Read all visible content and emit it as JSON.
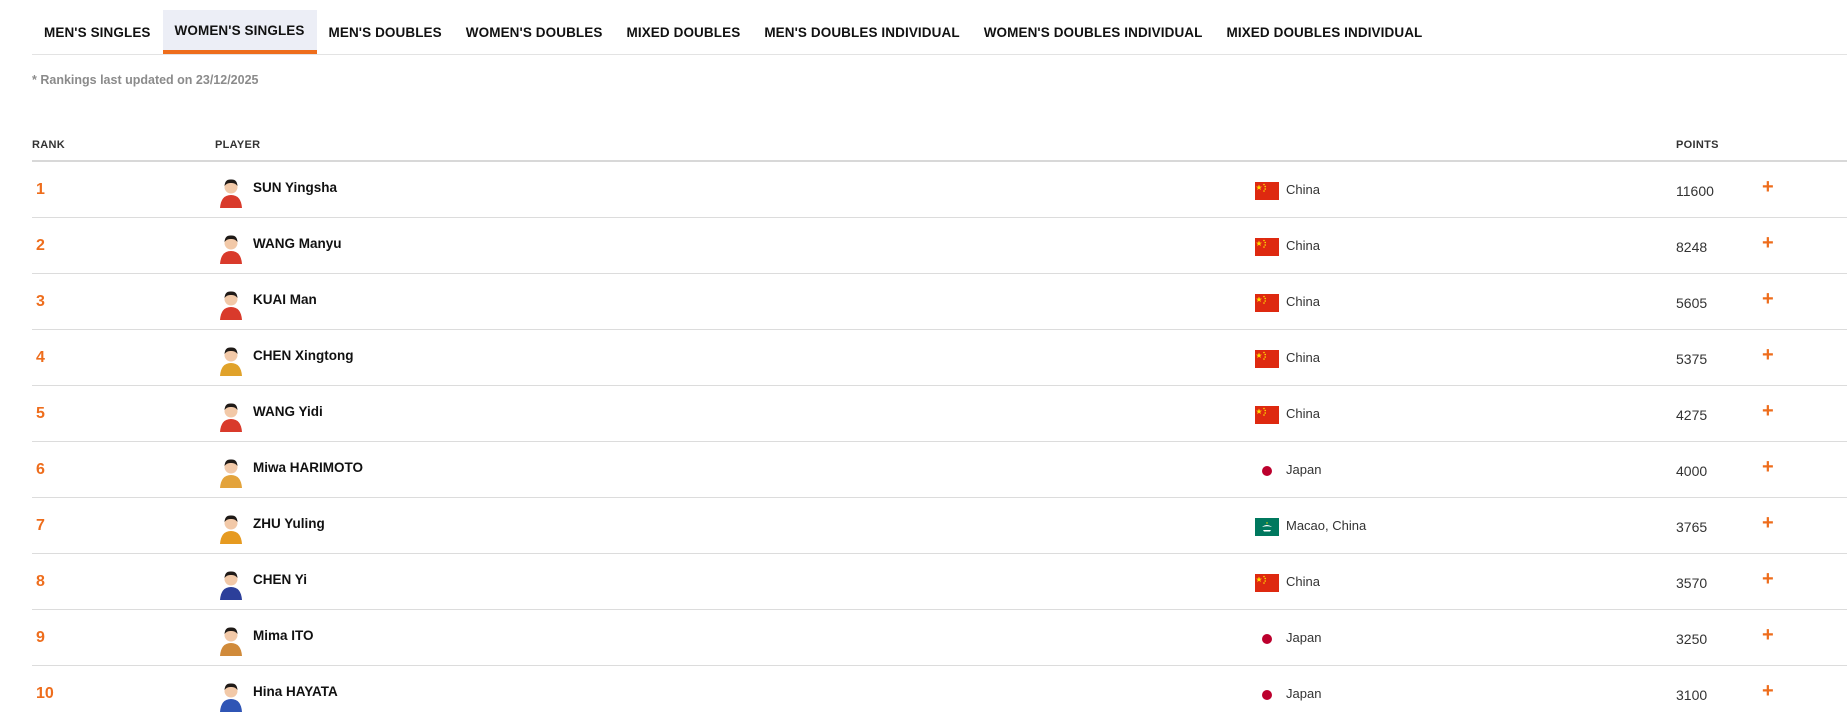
{
  "tabs": [
    {
      "label": "MEN'S SINGLES",
      "active": false
    },
    {
      "label": "WOMEN'S SINGLES",
      "active": true
    },
    {
      "label": "MEN'S DOUBLES",
      "active": false
    },
    {
      "label": "WOMEN'S DOUBLES",
      "active": false
    },
    {
      "label": "MIXED DOUBLES",
      "active": false
    },
    {
      "label": "MEN'S DOUBLES INDIVIDUAL",
      "active": false
    },
    {
      "label": "WOMEN'S DOUBLES INDIVIDUAL",
      "active": false
    },
    {
      "label": "MIXED DOUBLES INDIVIDUAL",
      "active": false
    }
  ],
  "note": "* Rankings last updated on 23/12/2025",
  "table": {
    "headers": {
      "rank": "RANK",
      "player": "PLAYER",
      "points": "POINTS"
    },
    "expand_icon": "+",
    "rows": [
      {
        "rank": "1",
        "name": "SUN Yingsha",
        "country": "China",
        "flag": "china-flag-icon",
        "points": "11600"
      },
      {
        "rank": "2",
        "name": "WANG Manyu",
        "country": "China",
        "flag": "china-flag-icon",
        "points": "8248"
      },
      {
        "rank": "3",
        "name": "KUAI Man",
        "country": "China",
        "flag": "china-flag-icon",
        "points": "5605"
      },
      {
        "rank": "4",
        "name": "CHEN Xingtong",
        "country": "China",
        "flag": "china-flag-icon",
        "points": "5375"
      },
      {
        "rank": "5",
        "name": "WANG Yidi",
        "country": "China",
        "flag": "china-flag-icon",
        "points": "4275"
      },
      {
        "rank": "6",
        "name": "Miwa HARIMOTO",
        "country": "Japan",
        "flag": "japan-flag-icon",
        "points": "4000"
      },
      {
        "rank": "7",
        "name": "ZHU Yuling",
        "country": "Macao, China",
        "flag": "macao-flag-icon",
        "points": "3765"
      },
      {
        "rank": "8",
        "name": "CHEN Yi",
        "country": "China",
        "flag": "china-flag-icon",
        "points": "3570"
      },
      {
        "rank": "9",
        "name": "Mima ITO",
        "country": "Japan",
        "flag": "japan-flag-icon",
        "points": "3250"
      },
      {
        "rank": "10",
        "name": "Hina HAYATA",
        "country": "Japan",
        "flag": "japan-flag-icon",
        "points": "3100"
      }
    ]
  },
  "colors": {
    "accent": "#ee6d1c",
    "active_tab_bg": "#eceef6",
    "china_red": "#de2910",
    "china_yellow": "#ffde00",
    "japan_red": "#bc002d",
    "macao_green": "#00785e"
  }
}
